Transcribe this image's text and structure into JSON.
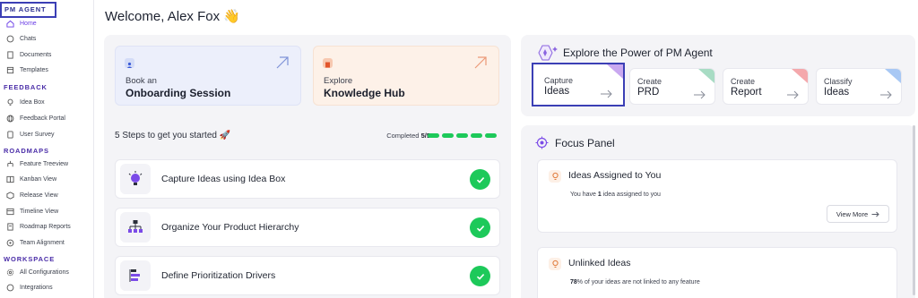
{
  "sidebar": {
    "sections": [
      {
        "title": "PM AGENT",
        "items": [
          {
            "label": "Home",
            "icon": "home-icon"
          },
          {
            "label": "Chats",
            "icon": "chat-icon"
          },
          {
            "label": "Documents",
            "icon": "document-icon"
          },
          {
            "label": "Templates",
            "icon": "template-icon"
          }
        ]
      },
      {
        "title": "FEEDBACK",
        "items": [
          {
            "label": "Idea Box",
            "icon": "lightbulb-icon"
          },
          {
            "label": "Feedback Portal",
            "icon": "globe-icon"
          },
          {
            "label": "User Survey",
            "icon": "survey-icon"
          }
        ]
      },
      {
        "title": "ROADMAPS",
        "items": [
          {
            "label": "Feature Treeview",
            "icon": "tree-icon"
          },
          {
            "label": "Kanban View",
            "icon": "kanban-icon"
          },
          {
            "label": "Release View",
            "icon": "release-icon"
          },
          {
            "label": "Timeline View",
            "icon": "timeline-icon"
          },
          {
            "label": "Roadmap Reports",
            "icon": "report-icon"
          },
          {
            "label": "Team Alignment",
            "icon": "team-icon"
          }
        ]
      },
      {
        "title": "WORKSPACE",
        "items": [
          {
            "label": "All Configurations",
            "icon": "gear-icon"
          },
          {
            "label": "Integrations",
            "icon": "plug-icon"
          }
        ]
      }
    ]
  },
  "header": {
    "welcome": "Welcome, Alex Fox 👋"
  },
  "quick_cards": [
    {
      "line1": "Book an",
      "line2": "Onboarding Session"
    },
    {
      "line1": "Explore",
      "line2": "Knowledge Hub"
    }
  ],
  "steps": {
    "title": "5 Steps to get you started 🚀",
    "completed_label": "Completed",
    "completed_value": "5/5",
    "progress": 1.0,
    "items": [
      {
        "label": "Capture Ideas using Idea Box",
        "icon": "lightbulb-icon",
        "done": true
      },
      {
        "label": "Organize Your Product Hierarchy",
        "icon": "hierarchy-icon",
        "done": true
      },
      {
        "label": "Define Prioritization Drivers",
        "icon": "priority-icon",
        "done": true
      }
    ]
  },
  "explore": {
    "title": "Explore the Power of PM Agent",
    "tiles": [
      {
        "line1": "Capture",
        "line2": "Ideas",
        "accent": "#c9a8f0"
      },
      {
        "line1": "Create",
        "line2": "PRD",
        "accent": "#a8dcc4"
      },
      {
        "line1": "Create",
        "line2": "Report",
        "accent": "#f4a8ac"
      },
      {
        "line1": "Classify",
        "line2": "Ideas",
        "accent": "#a8c8f4"
      }
    ]
  },
  "focus": {
    "title": "Focus Panel",
    "cards": [
      {
        "title": "Ideas Assigned to You",
        "desc_pre": "You have ",
        "desc_bold": "1",
        "desc_post": " idea assigned to you",
        "button": "View More"
      },
      {
        "title": "Unlinked Ideas",
        "desc_pre": "",
        "desc_bold": "78",
        "desc_post": "% of your ideas are not linked to any feature",
        "button": ""
      }
    ]
  },
  "colors": {
    "accent": "#6b3ee6",
    "success": "#1dc95a",
    "highlight": "#3b3fb5"
  }
}
